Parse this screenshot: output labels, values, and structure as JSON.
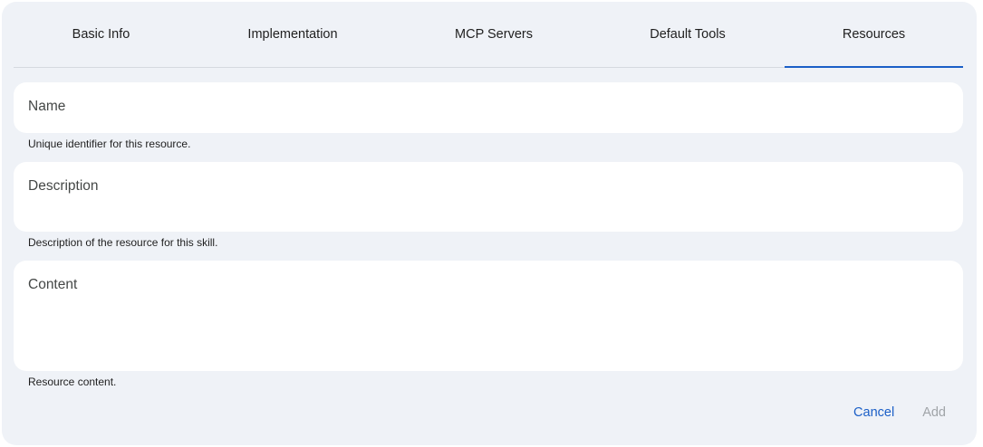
{
  "tabs": [
    {
      "label": "Basic Info"
    },
    {
      "label": "Implementation"
    },
    {
      "label": "MCP Servers"
    },
    {
      "label": "Default Tools"
    },
    {
      "label": "Resources",
      "active": true
    }
  ],
  "form": {
    "name": {
      "label": "Name",
      "hint": "Unique identifier for this resource."
    },
    "description": {
      "label": "Description",
      "hint": "Description of the resource for this skill."
    },
    "content": {
      "label": "Content",
      "hint": "Resource content."
    }
  },
  "actions": {
    "cancel_label": "Cancel",
    "add_label": "Add",
    "add_disabled": true
  },
  "colors": {
    "accent": "#1b5fc7",
    "dialog_bg": "#eff2f7",
    "field_bg": "#ffffff",
    "disabled_text": "#a0a4a8"
  }
}
